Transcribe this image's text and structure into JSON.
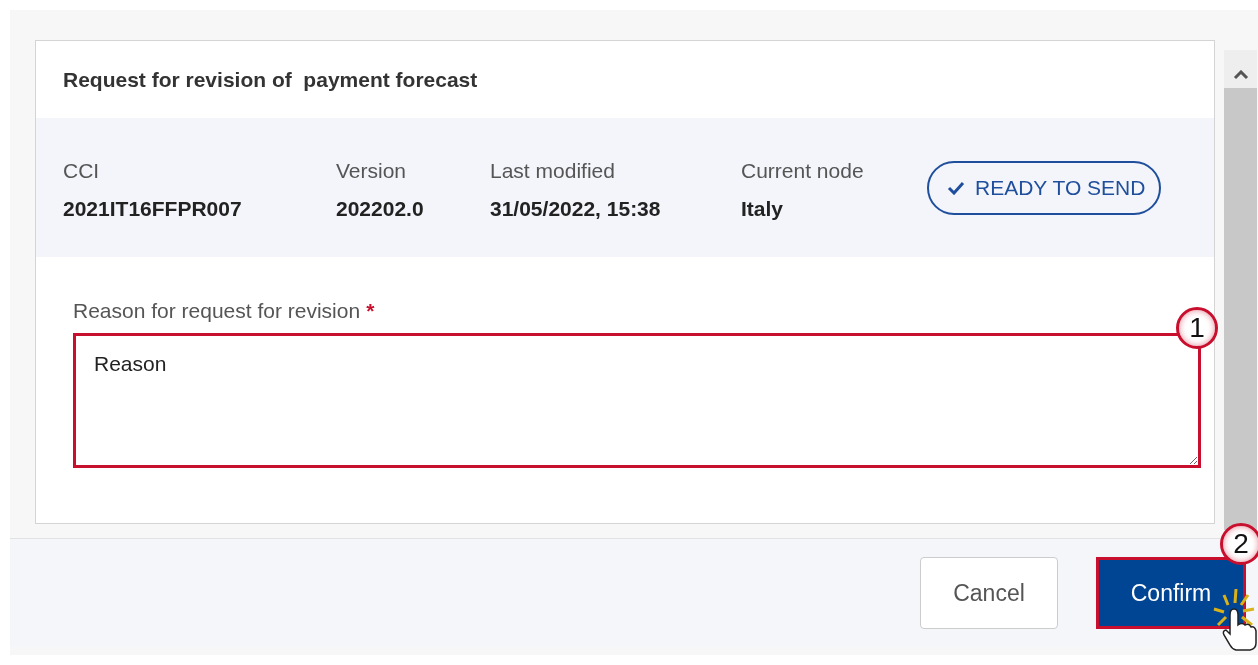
{
  "dialog": {
    "title": "Request for revision of  payment forecast",
    "meta": [
      {
        "label": "CCI",
        "value": "2021IT16FFPR007"
      },
      {
        "label": "Version",
        "value": "202202.0"
      },
      {
        "label": "Last modified",
        "value": "31/05/2022, 15:38"
      },
      {
        "label": "Current node",
        "value": "Italy"
      }
    ],
    "status": {
      "label": "READY TO SEND"
    },
    "reason_field": {
      "label": "Reason for request for revision",
      "required_mark": "*",
      "value": "Reason",
      "callout": "1"
    }
  },
  "buttons": [
    {
      "label": "Cancel",
      "kind": "secondary",
      "highlighted": false
    },
    {
      "label": "Confirm",
      "kind": "primary",
      "highlighted": true,
      "callout": "2"
    }
  ]
}
